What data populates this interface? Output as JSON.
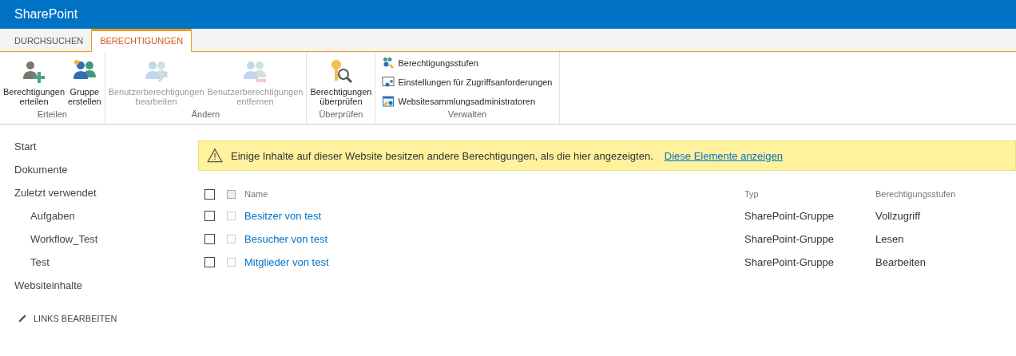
{
  "suite_bar": {
    "title": "SharePoint"
  },
  "tabs": [
    {
      "label": "DURCHSUCHEN",
      "selected": false
    },
    {
      "label": "BERECHTIGUNGEN",
      "selected": true
    }
  ],
  "ribbon": {
    "groups": [
      {
        "label": "Erteilen",
        "buttons": [
          {
            "kind": "large",
            "lines": [
              "Berechtigungen",
              "erteilen"
            ],
            "disabled": false
          },
          {
            "kind": "large",
            "lines": [
              "Gruppe",
              "erstellen"
            ],
            "disabled": false
          }
        ]
      },
      {
        "label": "Ändern",
        "buttons": [
          {
            "kind": "large",
            "lines": [
              "Benutzerberechtigungen",
              "bearbeiten"
            ],
            "disabled": true
          },
          {
            "kind": "large",
            "lines": [
              "Benutzerberechtigungen",
              "entfernen"
            ],
            "disabled": true
          }
        ]
      },
      {
        "label": "Überprüfen",
        "buttons": [
          {
            "kind": "large",
            "lines": [
              "Berechtigungen",
              "überprüfen"
            ],
            "disabled": false
          }
        ]
      },
      {
        "label": "Verwalten",
        "buttons": [
          {
            "kind": "small",
            "lines": [
              "Berechtigungsstufen"
            ],
            "disabled": false
          },
          {
            "kind": "small",
            "lines": [
              "Einstellungen für Zugriffsanforderungen"
            ],
            "disabled": false
          },
          {
            "kind": "small",
            "lines": [
              "Websitesammlungsadministratoren"
            ],
            "disabled": false
          }
        ]
      }
    ]
  },
  "nav": {
    "items": [
      {
        "label": "Start"
      },
      {
        "label": "Dokumente"
      },
      {
        "label": "Zuletzt verwendet",
        "children": [
          {
            "label": "Aufgaben"
          },
          {
            "label": "Workflow_Test"
          },
          {
            "label": "Test"
          }
        ]
      },
      {
        "label": "Websiteinhalte"
      }
    ],
    "edit_links": "LINKS BEARBEITEN"
  },
  "notice": {
    "text": "Einige Inhalte auf dieser Website besitzen andere Berechtigungen, als die hier angezeigten.",
    "link": "Diese Elemente anzeigen"
  },
  "table": {
    "columns": [
      "Name",
      "Typ",
      "Berechtigungsstufen"
    ],
    "all_checked": false,
    "rows": [
      {
        "name": "Besitzer von test",
        "type": "SharePoint-Gruppe",
        "level": "Vollzugriff",
        "checked": false
      },
      {
        "name": "Besucher von test",
        "type": "SharePoint-Gruppe",
        "level": "Lesen",
        "checked": false
      },
      {
        "name": "Mitglieder von test",
        "type": "SharePoint-Gruppe",
        "level": "Bearbeiten",
        "checked": false
      }
    ]
  }
}
